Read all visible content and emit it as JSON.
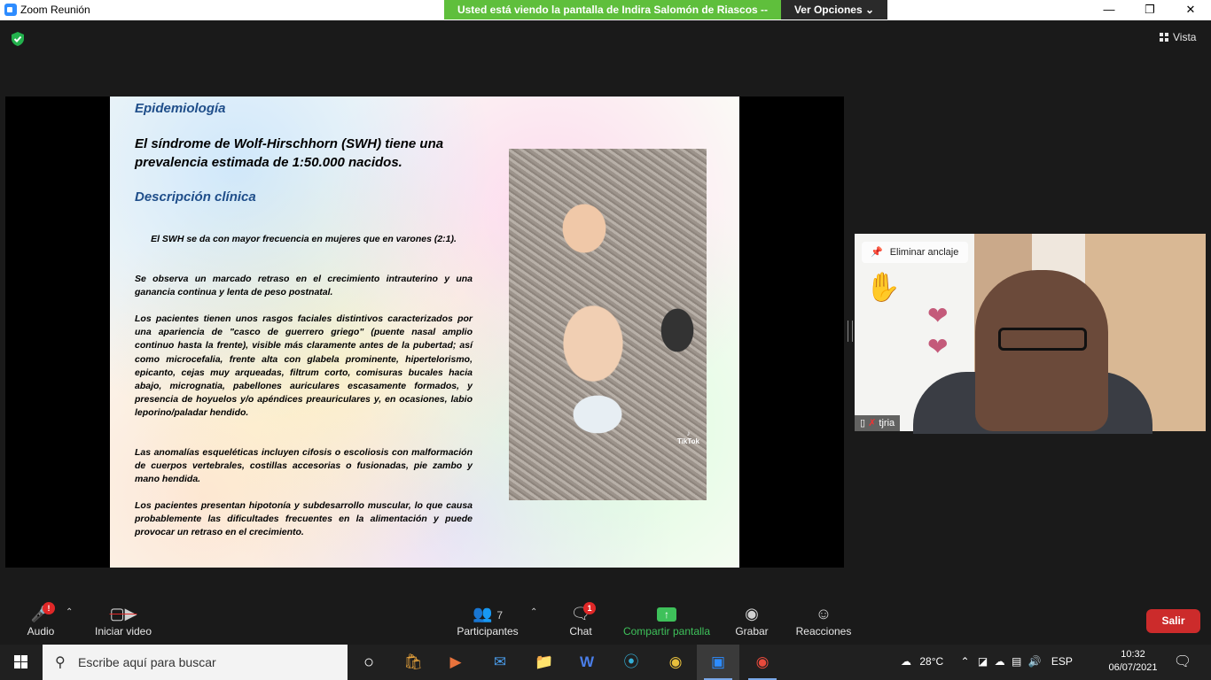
{
  "window": {
    "title": "Zoom Reunión",
    "share_banner": "Usted está viendo la pantalla de Indira Salomón de Riascos --",
    "view_options": "Ver Opciones"
  },
  "meeting_top": {
    "view_label": "Vista"
  },
  "slide": {
    "heading_epidemiology": "Epidemiología",
    "lead_line1": "El síndrome de Wolf-Hirschhorn (SWH) tiene una",
    "lead_line2": "prevalencia estimada de 1:50.000 nacidos.",
    "heading_clinical": "Descripción clínica",
    "para1": "El SWH se da con mayor frecuencia en mujeres que en varones (2:1).",
    "para2": "Se observa un marcado retraso en el crecimiento intrauterino y una ganancia continua y lenta de peso postnatal.",
    "para3": "Los pacientes tienen unos rasgos faciales distintivos caracterizados por una apariencia de \"casco de guerrero griego\" (puente nasal amplio continuo hasta la frente), visible más claramente antes de la pubertad; así como microcefalia, frente alta con glabela prominente, hipertelorismo, epicanto, cejas muy arqueadas, filtrum corto, comisuras bucales hacia abajo, micrognatia, pabellones auriculares escasamente formados, y presencia de hoyuelos y/o apéndices preauriculares y, en ocasiones, labio leporino/paladar hendido.",
    "para4": "Las anomalías esqueléticas incluyen cifosis o escoliosis con malformación de cuerpos vertebrales, costillas accesorias o fusionadas, pie zambo y mano hendida.",
    "para5": "Los pacientes presentan hipotonía y subdesarrollo muscular, lo que causa probablemente las dificultades frecuentes en la alimentación y puede provocar un retraso en el crecimiento.",
    "photo_watermark": "TikTok"
  },
  "participant": {
    "unpin_label": "Eliminar anclaje",
    "name": "tjria"
  },
  "toolbar": {
    "audio_label": "Audio",
    "audio_badge": "!",
    "video_label": "Iniciar video",
    "participants_label": "Participantes",
    "participants_count": "7",
    "chat_label": "Chat",
    "chat_badge": "1",
    "share_label": "Compartir pantalla",
    "record_label": "Grabar",
    "reactions_label": "Reacciones",
    "leave_label": "Salir"
  },
  "taskbar": {
    "search_placeholder": "Escribe aquí para buscar",
    "weather": "28°C",
    "language": "ESP",
    "time": "10:32",
    "date": "06/07/2021"
  },
  "colors": {
    "accent_green": "#3ec15a",
    "banner_green": "#5fbf3c",
    "leave_red": "#cc2b2b",
    "slide_heading": "#1f4e8a"
  }
}
